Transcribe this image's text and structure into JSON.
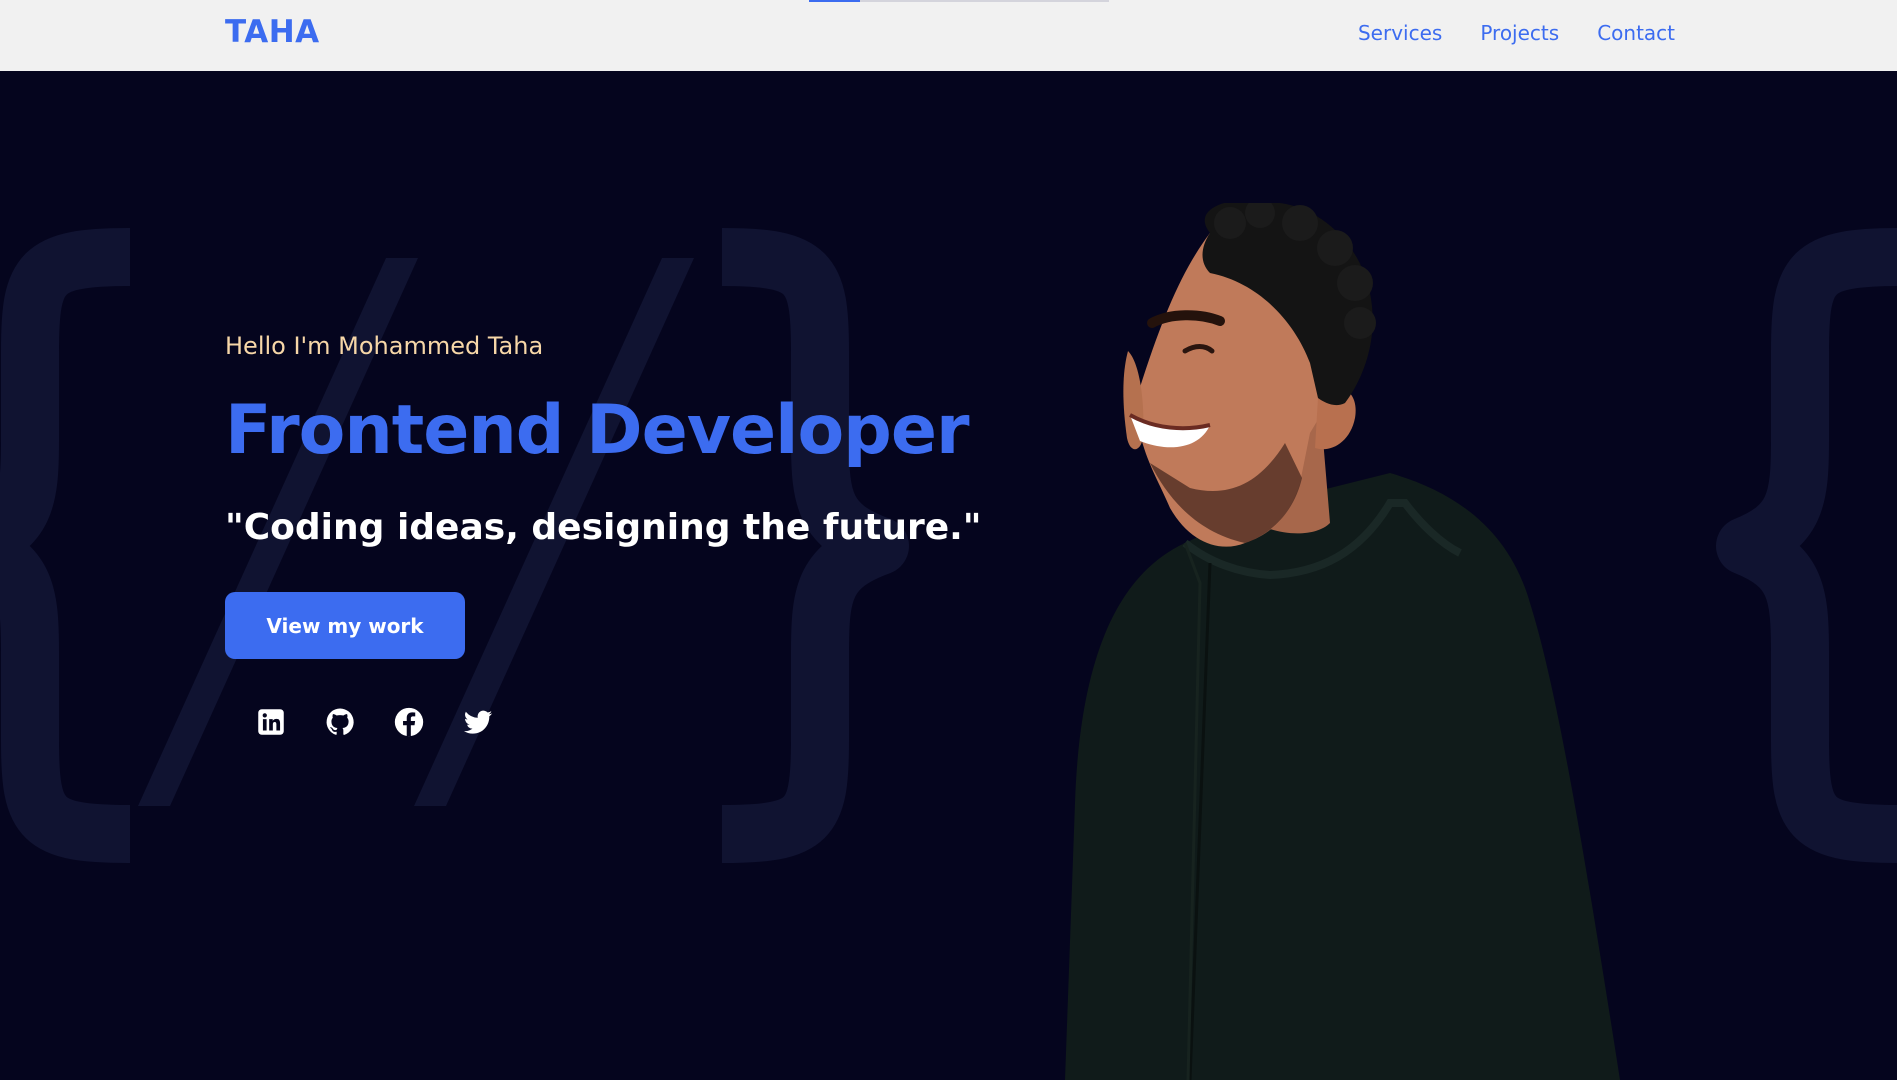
{
  "scroll_progress": 0.17,
  "nav": {
    "logo": "TAHA",
    "links": [
      {
        "label": "Services"
      },
      {
        "label": "Projects"
      },
      {
        "label": "Contact"
      }
    ]
  },
  "hero": {
    "greeting": "Hello I'm Mohammed Taha",
    "role": "Frontend Developer",
    "tagline": "\"Coding ideas, designing the future.\"",
    "cta_label": "View my work",
    "socials": [
      {
        "icon": "linkedin-icon"
      },
      {
        "icon": "github-icon"
      },
      {
        "icon": "facebook-icon"
      },
      {
        "icon": "twitter-icon"
      }
    ]
  },
  "colors": {
    "accent": "#3c6cf0",
    "background": "#05051e",
    "greeting": "#f7d7a8",
    "navbar": "#f1f1f1"
  }
}
